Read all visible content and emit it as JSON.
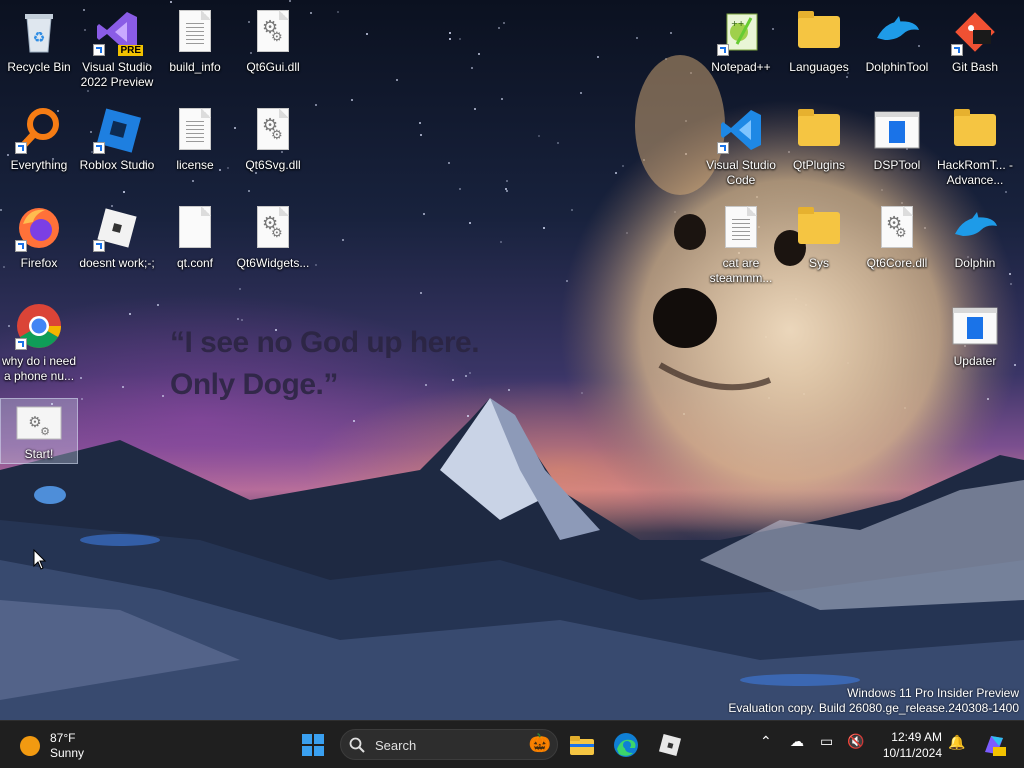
{
  "desktop": {
    "quote_line1": "“I see no God up here.",
    "quote_line2": "Only Doge.”",
    "watermark_line1": "Windows 11 Pro Insider Preview",
    "watermark_line2": "Evaluation copy. Build 26080.ge_release.240308-1400",
    "icons": [
      {
        "label": "Recycle Bin",
        "icon": "recycle-bin-icon"
      },
      {
        "label": "Visual Studio 2022 Preview",
        "icon": "visual-studio-icon",
        "badge": "PRE"
      },
      {
        "label": "build_info",
        "icon": "text-file-icon"
      },
      {
        "label": "Qt6Gui.dll",
        "icon": "dll-file-icon"
      },
      {
        "label": "Everything",
        "icon": "everything-search-icon"
      },
      {
        "label": "Roblox Studio",
        "icon": "roblox-studio-icon"
      },
      {
        "label": "license",
        "icon": "text-file-icon"
      },
      {
        "label": "Qt6Svg.dll",
        "icon": "dll-file-icon"
      },
      {
        "label": "Firefox",
        "icon": "firefox-icon"
      },
      {
        "label": "doesnt work;-;",
        "icon": "roblox-icon"
      },
      {
        "label": "qt.conf",
        "icon": "blank-file-icon"
      },
      {
        "label": "Qt6Widgets...",
        "icon": "dll-file-icon"
      },
      {
        "label": "why do i need a phone nu...",
        "icon": "chrome-icon"
      },
      {
        "label": "Start!",
        "icon": "settings-app-icon"
      },
      {
        "label": "Notepad++",
        "icon": "notepad-plus-plus-icon"
      },
      {
        "label": "Languages",
        "icon": "folder-icon"
      },
      {
        "label": "DolphinTool",
        "icon": "dolphin-icon"
      },
      {
        "label": "Git Bash",
        "icon": "git-bash-icon"
      },
      {
        "label": "Visual Studio Code",
        "icon": "vscode-icon"
      },
      {
        "label": "QtPlugins",
        "icon": "folder-icon"
      },
      {
        "label": "DSPTool",
        "icon": "app-window-icon"
      },
      {
        "label": "HackRomT... - Advance...",
        "icon": "folder-icon"
      },
      {
        "label": "cat are steammm...",
        "icon": "text-file-icon"
      },
      {
        "label": "Sys",
        "icon": "folder-icon"
      },
      {
        "label": "Qt6Core.dll",
        "icon": "dll-file-icon"
      },
      {
        "label": "Dolphin",
        "icon": "dolphin-icon"
      },
      {
        "label": "Updater",
        "icon": "app-window-icon"
      }
    ]
  },
  "taskbar": {
    "weather_temp": "87°F",
    "weather_condition": "Sunny",
    "search_label": "Search",
    "clock_time": "12:49 AM",
    "clock_date": "10/11/2024",
    "colors": {
      "background": "#1f1f1f",
      "accent": "#0078d4"
    }
  }
}
